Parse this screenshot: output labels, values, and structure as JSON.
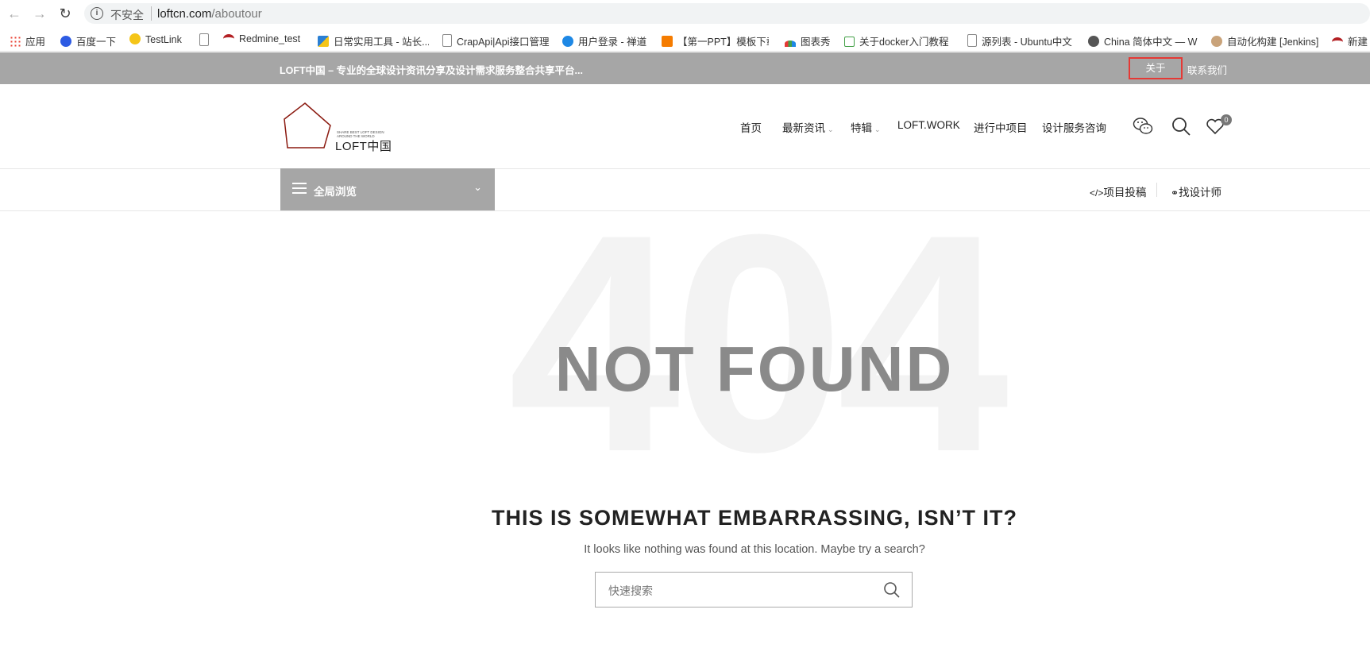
{
  "browser": {
    "insecure_label": "不安全",
    "url_host": "loftcn.com",
    "url_path": "/aboutour"
  },
  "bookmarks": [
    {
      "label": "应用",
      "icon": "apps-grid-icon",
      "color": "#4285f4"
    },
    {
      "label": "百度一下",
      "icon": "baidu-paw-icon",
      "color": "#2d5be3"
    },
    {
      "label": "TestLink",
      "icon": "testlink-icon",
      "color": "#f5c518"
    },
    {
      "label": "",
      "icon": "page-icon",
      "color": "#888888"
    },
    {
      "label": "Redmine_test",
      "icon": "redmine-icon",
      "color": "#b32024"
    },
    {
      "label": "日常实用工具 - 站长...",
      "icon": "tools-icon",
      "color": "#2a7fd4"
    },
    {
      "label": "CrapApi|Api接口管理",
      "icon": "page-icon",
      "color": "#888888"
    },
    {
      "label": "用户登录 - 禅道",
      "icon": "globe-icon",
      "color": "#1e88e5"
    },
    {
      "label": "【第一PPT】模板下载",
      "icon": "ppt-icon",
      "color": "#f57c00"
    },
    {
      "label": "图表秀",
      "icon": "chart-icon",
      "color": "#e53935"
    },
    {
      "label": "关于docker入门教程",
      "icon": "edit-icon",
      "color": "#43a047"
    },
    {
      "label": "源列表 - Ubuntu中文",
      "icon": "page-icon",
      "color": "#888888"
    },
    {
      "label": "China 简体中文 — W",
      "icon": "wordpress-icon",
      "color": "#555555"
    },
    {
      "label": "自动化构建 [Jenkins]",
      "icon": "jenkins-icon",
      "color": "#c9a37a"
    },
    {
      "label": "新建",
      "icon": "redmine-icon",
      "color": "#b32024"
    }
  ],
  "topbar": {
    "slogan": "LOFT中国 – 专业的全球设计资讯分享及设计需求服务整合共享平台...",
    "about": "关于",
    "contact": "联系我们"
  },
  "logo": {
    "tagline": "SHARE BEST LOFT DESIGN AROUND THE WORLD",
    "name": "LOFT中国",
    "color": "#8b1a10"
  },
  "nav": {
    "items": [
      {
        "label": "首页",
        "has_dropdown": false
      },
      {
        "label": "最新资讯",
        "has_dropdown": true
      },
      {
        "label": "特辑",
        "has_dropdown": true
      },
      {
        "label": "LOFT.WORK",
        "has_dropdown": false
      },
      {
        "label": "进行中项目",
        "has_dropdown": false
      },
      {
        "label": "设计服务咨询",
        "has_dropdown": false
      }
    ],
    "favorites_count": "0"
  },
  "subbar": {
    "browse_label": "全局浏览",
    "submit_project": "项目投稿",
    "find_designer": "找设计师"
  },
  "error": {
    "code": "404",
    "title": "NOT FOUND",
    "heading": "THIS IS SOMEWHAT EMBARRASSING, ISN’T IT?",
    "message": "It looks like nothing was found at this location. Maybe try a search?",
    "search_placeholder": "快速搜索"
  }
}
